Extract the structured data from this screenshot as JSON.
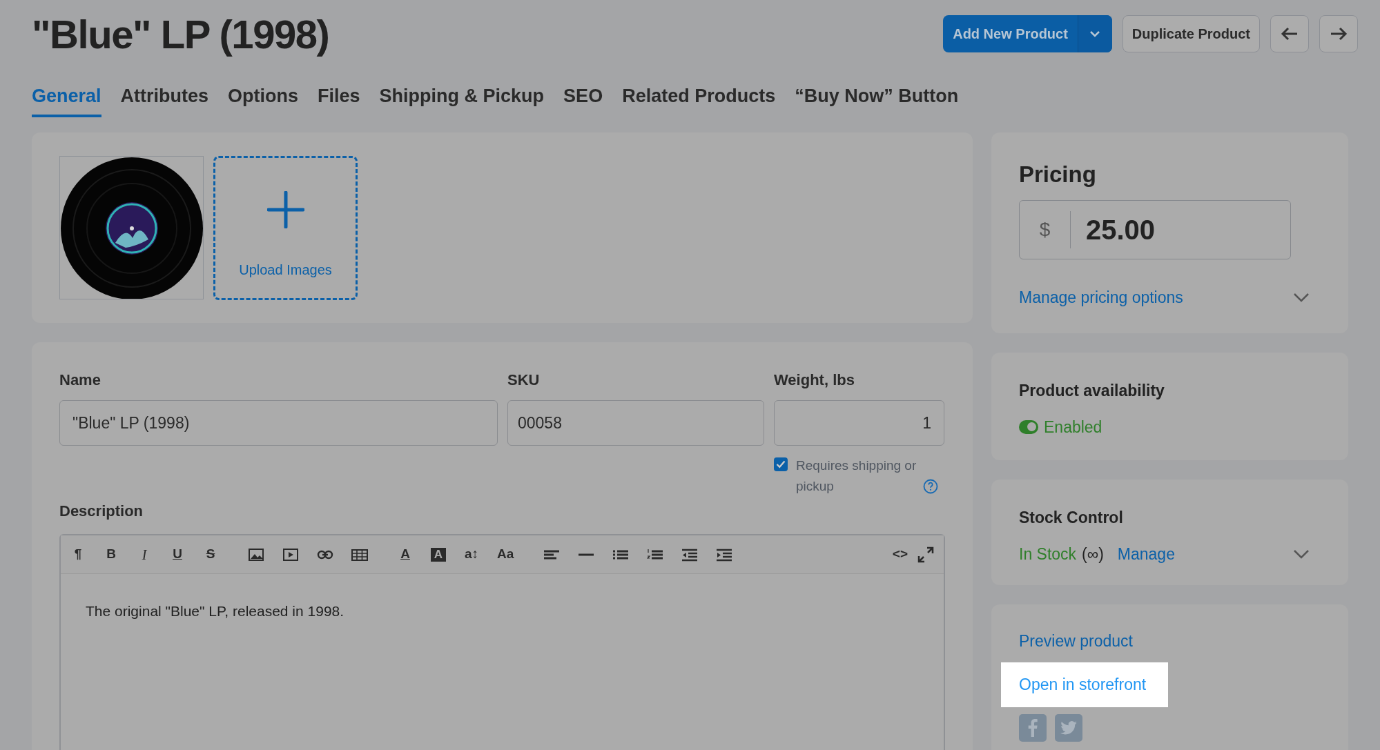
{
  "title": "\"Blue\" LP (1998)",
  "header_buttons": {
    "add_new": "Add New Product",
    "duplicate": "Duplicate Product"
  },
  "tabs": [
    {
      "label": "General",
      "selected": true
    },
    {
      "label": "Attributes",
      "selected": false
    },
    {
      "label": "Options",
      "selected": false
    },
    {
      "label": "Files",
      "selected": false
    },
    {
      "label": "Shipping & Pickup",
      "selected": false
    },
    {
      "label": "SEO",
      "selected": false
    },
    {
      "label": "Related Products",
      "selected": false
    },
    {
      "label": "“Buy Now” Button",
      "selected": false
    }
  ],
  "images": {
    "upload_label": "Upload Images"
  },
  "fields": {
    "name_label": "Name",
    "name_value": "\"Blue\" LP (1998)",
    "sku_label": "SKU",
    "sku_value": "00058",
    "weight_label": "Weight, lbs",
    "weight_value": "1"
  },
  "requires_shipping": {
    "label": "Requires shipping or pickup",
    "checked": true
  },
  "description": {
    "label": "Description",
    "text": "The original \"Blue\" LP, released in 1998.",
    "toolbar": [
      [
        {
          "kind": "glyph",
          "text": "¶"
        },
        {
          "kind": "glyph",
          "text": "B"
        },
        {
          "kind": "glyph",
          "text": "I"
        },
        {
          "kind": "glyph",
          "text": "U"
        },
        {
          "kind": "glyph",
          "text": "S"
        }
      ],
      [
        {
          "kind": "icon"
        },
        {
          "kind": "icon"
        },
        {
          "kind": "icon"
        },
        {
          "kind": "icon"
        }
      ],
      [
        {
          "kind": "glyph",
          "text": "A"
        },
        {
          "kind": "glyph",
          "text": "A"
        },
        {
          "kind": "glyph",
          "text": "a↕"
        },
        {
          "kind": "glyph",
          "text": "Aa"
        }
      ],
      [
        {
          "kind": "icon"
        },
        {
          "kind": "icon"
        },
        {
          "kind": "icon"
        },
        {
          "kind": "icon"
        },
        {
          "kind": "icon"
        },
        {
          "kind": "icon"
        }
      ]
    ],
    "toolbar_right": [
      {
        "kind": "glyph",
        "text": "<>"
      },
      {
        "kind": "icon"
      }
    ]
  },
  "pricing": {
    "title": "Pricing",
    "currency": "$",
    "price": "25.00",
    "manage_link": "Manage pricing options"
  },
  "availability": {
    "title": "Product availability",
    "status": "Enabled",
    "on": true
  },
  "stock": {
    "title": "Stock Control",
    "status": "In Stock",
    "quantity": "(∞)",
    "manage_link": "Manage"
  },
  "links": {
    "preview": "Preview product",
    "open_storefront": "Open in storefront",
    "open_storefront_highlighted": true
  }
}
